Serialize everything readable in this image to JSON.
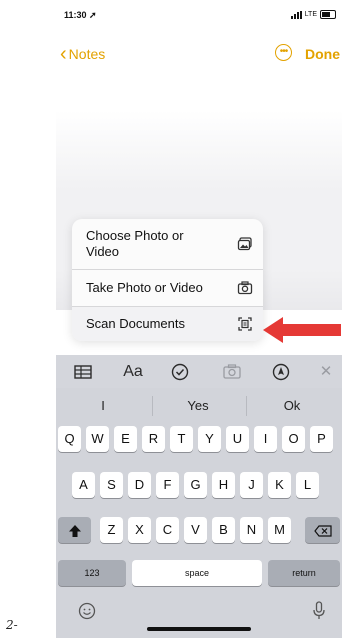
{
  "page_label": "2-",
  "status_bar": {
    "time": "11:30",
    "network": "LTE"
  },
  "nav": {
    "back_label": "Notes",
    "done_label": "Done"
  },
  "menu": {
    "items": [
      {
        "label": "Choose Photo or Video",
        "icon": "photo-library-icon"
      },
      {
        "label": "Take Photo or Video",
        "icon": "camera-icon"
      },
      {
        "label": "Scan Documents",
        "icon": "scan-document-icon"
      }
    ]
  },
  "toolbar": {
    "icons": [
      "table-icon",
      "text-format-icon",
      "checklist-icon",
      "camera-icon",
      "markup-icon",
      "close-icon"
    ],
    "format_label": "Aa"
  },
  "keyboard": {
    "predictions": [
      "I",
      "Yes",
      "Ok"
    ],
    "row1": [
      "Q",
      "W",
      "E",
      "R",
      "T",
      "Y",
      "U",
      "I",
      "O",
      "P"
    ],
    "row2": [
      "A",
      "S",
      "D",
      "F",
      "G",
      "H",
      "J",
      "K",
      "L"
    ],
    "row3": [
      "Z",
      "X",
      "C",
      "V",
      "B",
      "N",
      "M"
    ],
    "numbers_label": "123",
    "space_label": "space",
    "return_label": "return"
  },
  "colors": {
    "accent": "#e3a200",
    "arrow": "#e53935",
    "keyboard_bg": "#d2d4da"
  }
}
